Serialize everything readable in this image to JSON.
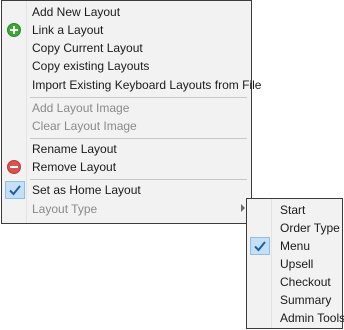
{
  "main_menu": {
    "items": [
      {
        "label": "Add New Layout",
        "disabled": false
      },
      {
        "label": "Link a Layout",
        "disabled": false,
        "icon": "add-circle-icon"
      },
      {
        "label": "Copy Current Layout",
        "disabled": false
      },
      {
        "label": "Copy existing Layouts",
        "disabled": false
      },
      {
        "label": "Import Existing Keyboard Layouts from File",
        "disabled": false
      },
      {
        "label": "Add Layout Image",
        "disabled": true
      },
      {
        "label": "Clear Layout Image",
        "disabled": true
      },
      {
        "label": "Rename Layout",
        "disabled": false
      },
      {
        "label": "Remove Layout",
        "disabled": false,
        "icon": "remove-circle-icon"
      },
      {
        "label": "Set as Home Layout",
        "disabled": false,
        "checked": true
      },
      {
        "label": "Layout Type",
        "disabled": true,
        "has_submenu": true
      }
    ]
  },
  "sub_menu": {
    "items": [
      {
        "label": "Start"
      },
      {
        "label": "Order Type"
      },
      {
        "label": "Menu",
        "checked": true
      },
      {
        "label": "Upsell"
      },
      {
        "label": "Checkout"
      },
      {
        "label": "Summary"
      },
      {
        "label": "Admin Tools"
      }
    ]
  },
  "colors": {
    "add_icon": "#3aa935",
    "remove_icon": "#d9534f",
    "check_mark": "#1c5ea8",
    "check_highlight": "#c5e0f5"
  }
}
